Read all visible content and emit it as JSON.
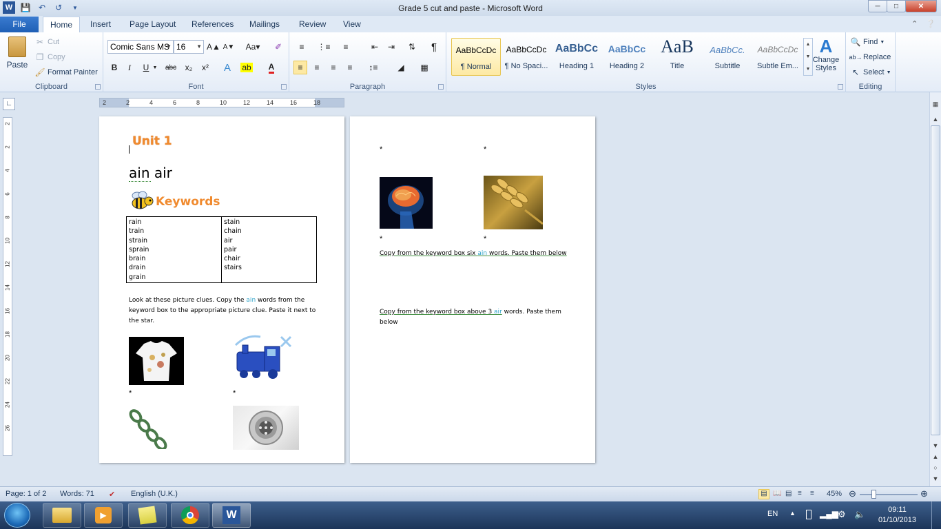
{
  "window": {
    "title": "Grade 5 cut and paste  -  Microsoft Word"
  },
  "tabs": {
    "file": "File",
    "home": "Home",
    "insert": "Insert",
    "page_layout": "Page Layout",
    "references": "References",
    "mailings": "Mailings",
    "review": "Review",
    "view": "View"
  },
  "clipboard": {
    "paste": "Paste",
    "cut": "Cut",
    "copy": "Copy",
    "format_painter": "Format Painter",
    "label": "Clipboard"
  },
  "font": {
    "name": "Comic Sans MS",
    "size": "16",
    "label": "Font"
  },
  "paragraph": {
    "label": "Paragraph"
  },
  "styles": {
    "label": "Styles",
    "items": [
      {
        "sample": "AaBbCcDc",
        "name": "¶ Normal"
      },
      {
        "sample": "AaBbCcDc",
        "name": "¶ No Spaci..."
      },
      {
        "sample": "AaBbCc",
        "name": "Heading 1"
      },
      {
        "sample": "AaBbCc",
        "name": "Heading 2"
      },
      {
        "sample": "AaB",
        "name": "Title"
      },
      {
        "sample": "AaBbCc.",
        "name": "Subtitle"
      },
      {
        "sample": "AaBbCcDc",
        "name": "Subtle Em..."
      }
    ],
    "change_styles": "Change Styles"
  },
  "editing": {
    "find": "Find",
    "replace": "Replace",
    "select": "Select",
    "label": "Editing"
  },
  "ruler": {
    "h": [
      "2",
      "2",
      "4",
      "6",
      "8",
      "10",
      "12",
      "14",
      "16",
      "18"
    ],
    "v": [
      "2",
      "2",
      "4",
      "6",
      "8",
      "10",
      "12",
      "14",
      "16",
      "18",
      "20",
      "22",
      "24",
      "26"
    ]
  },
  "doc": {
    "unit": "Unit 1",
    "ain_air": "ain  air",
    "keywords": "Keywords",
    "col1": [
      "rain",
      "train",
      "strain",
      "sprain",
      "brain",
      "drain",
      "grain"
    ],
    "col2": [
      "stain",
      "chain",
      "air",
      "pair",
      "chair",
      "stairs"
    ],
    "para1_a": "Look at these picture clues. Copy the ",
    "para1_ain": "ain",
    "para1_b": " words from the keyword box to the appropriate picture clue. Paste it next to the star.",
    "star": "*",
    "p2_para1_a": "Copy from the keyword box six ",
    "p2_para1_ain": "ain",
    "p2_para1_b": " words. Paste them below",
    "p2_para2_a": "Copy from the keyword box above 3 ",
    "p2_para2_air": "air",
    "p2_para2_b": " words. Paste them below"
  },
  "status": {
    "page": "Page: 1 of 2",
    "words": "Words: 71",
    "lang": "English (U.K.)",
    "zoom": "45%"
  },
  "taskbar": {
    "lang": "EN",
    "time": "09:11",
    "date": "01/10/2013"
  }
}
